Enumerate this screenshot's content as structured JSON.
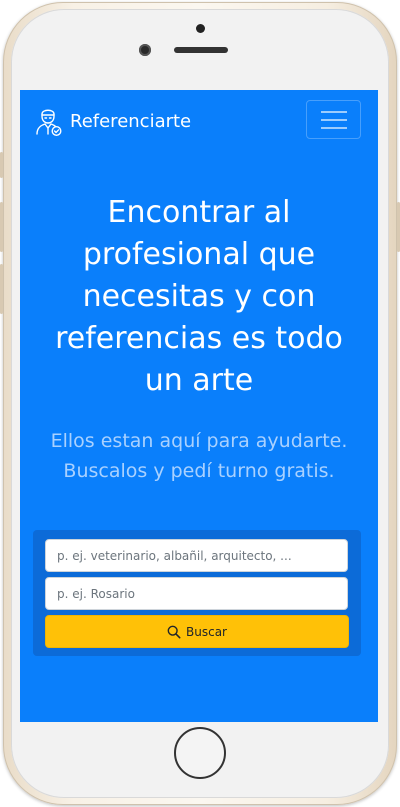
{
  "navbar": {
    "brand_icon": "doctor-user-icon",
    "brand": "Referenciarte",
    "menu_icon": "hamburger-menu-icon"
  },
  "hero": {
    "title": "Encontrar al profesional que necesitas y con referencias es todo un arte",
    "subtitle": "Ellos estan aquí para ayudarte. Buscalos y pedí turno gratis."
  },
  "search": {
    "query_placeholder": "p. ej. veterinario, albañil, arquitecto, ...",
    "query_value": "",
    "location_placeholder": "p. ej. Rosario",
    "location_value": "",
    "button_label": "Buscar",
    "button_icon": "search-icon"
  },
  "colors": {
    "background": "#0a7ffb",
    "search_card": "#0c6bd8",
    "button": "#ffc107",
    "subtitle": "#a9d1ff"
  }
}
